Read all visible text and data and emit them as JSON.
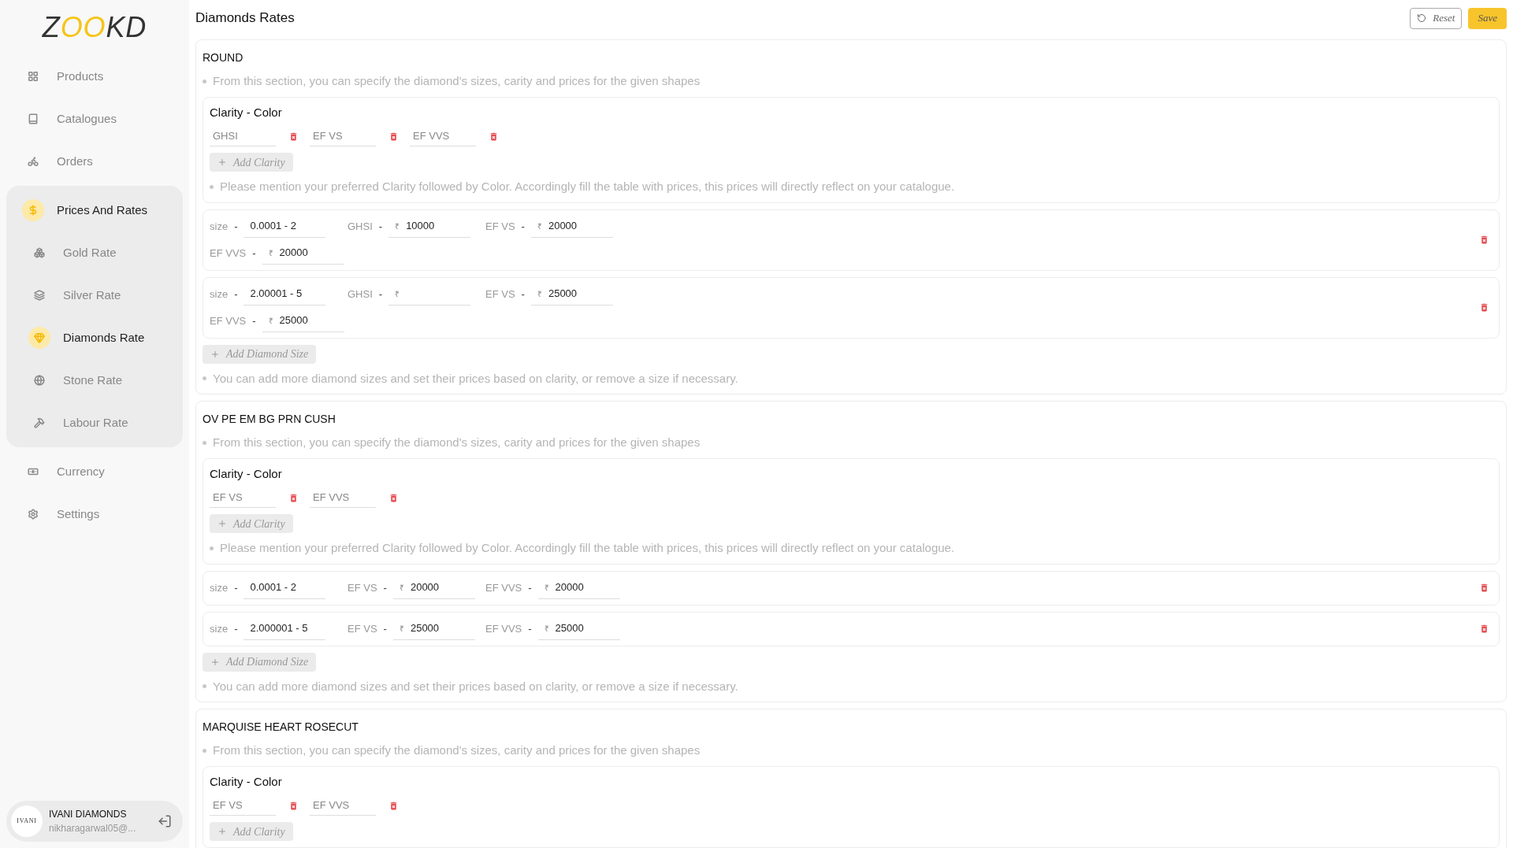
{
  "logo": {
    "parts": [
      {
        "text": "Z",
        "accent": false
      },
      {
        "text": "OO",
        "accent": true
      },
      {
        "text": "KD",
        "accent": false
      }
    ]
  },
  "nav": [
    {
      "label": "Products",
      "selected": false
    },
    {
      "label": "Catalogues",
      "selected": false
    },
    {
      "label": "Orders",
      "selected": false
    },
    {
      "label": "Prices And Rates",
      "selected": true,
      "expanded": true,
      "children": [
        {
          "label": "Gold Rate",
          "selected": false
        },
        {
          "label": "Silver Rate",
          "selected": false
        },
        {
          "label": "Diamonds Rate",
          "selected": true
        },
        {
          "label": "Stone Rate",
          "selected": false
        },
        {
          "label": "Labour Rate",
          "selected": false
        }
      ]
    },
    {
      "label": "Currency",
      "selected": false
    },
    {
      "label": "Settings",
      "selected": false
    }
  ],
  "user": {
    "avatar_text": "IVANI",
    "name": "IVANI DIAMONDS",
    "email": "nikharagarwal05@..."
  },
  "header": {
    "title": "Diamonds Rates",
    "buttons": [
      {
        "label": "Reset",
        "kind": "outline"
      },
      {
        "label": "Save",
        "kind": "primary"
      }
    ]
  },
  "sections": [
    {
      "title": "ROUND",
      "note": "From this section, you can specify the diamond's sizes, carity and prices for the given shapes",
      "clarity": {
        "heading": "Clarity - Color",
        "items": [
          "GHSI",
          "EF VS",
          "EF VVS"
        ],
        "add_label": "Add Clarity",
        "note": "Please mention your preferred Clarity followed by Color. Accordingly fill the table with prices, this prices will directly reflect on your catalogue."
      },
      "sizes": [
        {
          "label": "size",
          "dash": "-",
          "value": "0.0001 - 2",
          "prices": [
            {
              "label": "GHSI",
              "dash": "-",
              "symbol": "₹",
              "value": "10000"
            },
            {
              "label": "EF VS",
              "dash": "-",
              "symbol": "₹",
              "value": "20000"
            },
            {
              "label": "EF VVS",
              "dash": "-",
              "symbol": "₹",
              "value": "20000"
            }
          ]
        },
        {
          "label": "size",
          "dash": "-",
          "value": "2.00001 - 5",
          "prices": [
            {
              "label": "GHSI",
              "dash": "-",
              "symbol": "₹"
            },
            {
              "label": "EF VS",
              "dash": "-",
              "symbol": "₹",
              "value": "25000"
            },
            {
              "label": "EF VVS",
              "dash": "-",
              "symbol": "₹",
              "value": "25000"
            }
          ]
        }
      ],
      "add_size_label": "Add Diamond Size",
      "footer_note": "You can add more diamond sizes and set their prices based on clarity, or remove a size if necessary."
    },
    {
      "title": "OV PE EM BG PRN CUSH",
      "note": "From this section, you can specify the diamond's sizes, carity and prices for the given shapes",
      "clarity": {
        "heading": "Clarity - Color",
        "items": [
          "EF VS",
          "EF VVS"
        ],
        "add_label": "Add Clarity",
        "note": "Please mention your preferred Clarity followed by Color. Accordingly fill the table with prices, this prices will directly reflect on your catalogue."
      },
      "sizes": [
        {
          "label": "size",
          "dash": "-",
          "value": "0.0001 - 2",
          "prices": [
            {
              "label": "EF VS",
              "dash": "-",
              "symbol": "₹",
              "value": "20000"
            },
            {
              "label": "EF VVS",
              "dash": "-",
              "symbol": "₹",
              "value": "20000"
            }
          ]
        },
        {
          "label": "size",
          "dash": "-",
          "value": "2.000001 - 5",
          "prices": [
            {
              "label": "EF VS",
              "dash": "-",
              "symbol": "₹",
              "value": "25000"
            },
            {
              "label": "EF VVS",
              "dash": "-",
              "symbol": "₹",
              "value": "25000"
            }
          ]
        }
      ],
      "add_size_label": "Add Diamond Size",
      "footer_note": "You can add more diamond sizes and set their prices based on clarity, or remove a size if necessary."
    },
    {
      "title": "MARQUISE HEART ROSECUT",
      "note": "From this section, you can specify the diamond's sizes, carity and prices for the given shapes",
      "clarity": {
        "heading": "Clarity - Color",
        "items": [
          "EF VS",
          "EF VVS"
        ],
        "add_label": "Add Clarity"
      }
    }
  ]
}
